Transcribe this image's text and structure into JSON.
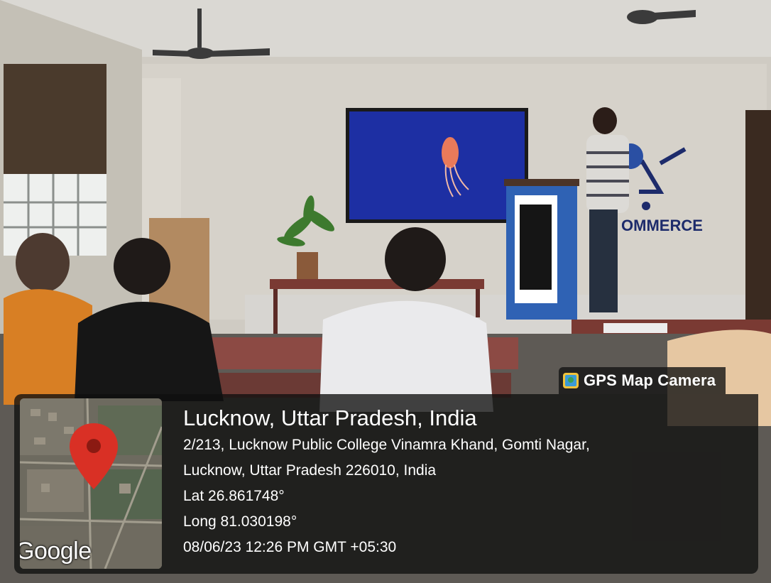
{
  "badge": {
    "label": "GPS Map Camera",
    "icon": "gps-map-camera-app-icon"
  },
  "location": {
    "title": "Lucknow, Uttar Pradesh, India",
    "address_line1": "2/213, Lucknow Public College Vinamra Khand, Gomti Nagar,",
    "address_line2": "Lucknow, Uttar Pradesh 226010, India",
    "latitude": "Lat 26.861748°",
    "longitude": "Long 81.030198°",
    "datetime": "08/06/23 12:26 PM GMT +05:30"
  },
  "map": {
    "attribution": "Google",
    "pin_icon": "map-pin-icon",
    "pin_color": "#d93025"
  },
  "scene": {
    "wall_sign": "OMMERCE"
  }
}
